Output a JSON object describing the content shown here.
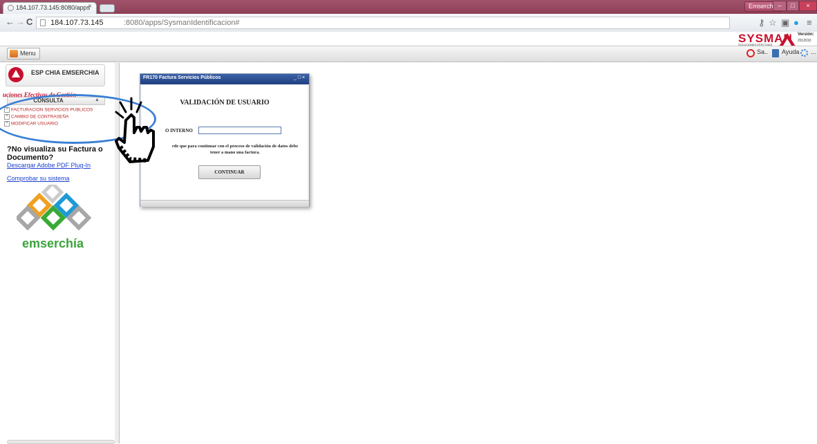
{
  "browser": {
    "tab_title": "184.107.73.145:8080/apps",
    "tab_close": "×",
    "user_badge": "Emserchia",
    "window_controls": [
      "–",
      "□",
      "×"
    ],
    "url_host": "184.107.73.145",
    "url_path": ":8080/apps/SysmanIdentificacion#"
  },
  "app_header": {
    "brand": "SYSMAN",
    "brand_sub": "SOLUCIONES EFECTIVAS",
    "version_label": "Versión:",
    "version_number": "2012010"
  },
  "toolbar": {
    "menu_label": "Menu",
    "exit_label": "Sa..",
    "help_label": "Ayuda",
    "more_label": "..."
  },
  "sidebar": {
    "company_name": "ESP CHIA EMSERCHIA",
    "tagline": "uciones Efectivas de Gestión",
    "section_label": "CONSULTA",
    "section_arrow": "▲",
    "items": [
      {
        "label": "FACTURACION SERVICIOS PUBLICOS"
      },
      {
        "label": "CAMBIO DE CONTRASEÑA"
      },
      {
        "label": "MODIFICAR USUARIO"
      }
    ],
    "pdf_question": "?No visualiza su Factura o Documento?",
    "pdf_link": "Descargar Adobe PDF Plug-In",
    "check_link": "Comprobar su sistema",
    "logo_word": "emserchía"
  },
  "dialog": {
    "title": "FR170 Factura Servicios Públicos",
    "controls": "_ □ ×",
    "heading": "VALIDACIÓN DE USUARIO",
    "field_label": "O INTERNO",
    "field_value": "",
    "note": "rde que para continuar con el proceso de validación de datos debe tener a mano una factura.",
    "continue_label": "CONTINUAR"
  },
  "colors": {
    "brand_red": "#c8102e",
    "dialog_title_bg": "#1f3f80",
    "annotation_blue": "#3a7fd5",
    "logo_green": "#3aa33a"
  }
}
